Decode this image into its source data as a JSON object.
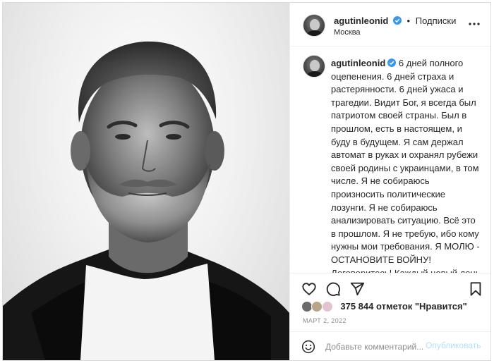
{
  "post": {
    "username": "agutinleonid",
    "follow_label": "Подписки",
    "location": "Москва",
    "caption": "6 дней полного оцепенения. 6 дней страха и растерянности. 6 дней ужаса и трагедии. Видит Бог, я всегда был патриотом своей страны. Был в прошлом, есть в настоящем, и буду в будущем. Я сам держал автомат в руках и охранял рубежи своей родины с украинцами, в том числе. Я не собираюсь произносить политические лозунги. Я не собираюсь анализировать ситуацию. Всё это в прошлом. Я не требую, ибо кому нужны мои требования. Я МОЛЮ - ОСТАНОВИТЕ ВОЙНУ! Договоритесь! Каждый новый день - это новые смерти наших ребят, украинских граждан, миллионы поломанных судеб с той и с другой",
    "likes_text": "375 844 отметок \"Нравится\"",
    "date": "МАРТ 2, 2022",
    "comment_placeholder": "Добавьте комментарий...",
    "publish_label": "Опубликовать"
  },
  "icons": {
    "verified": "verified-badge-icon",
    "more": "more-options-icon",
    "like": "heart-icon",
    "comment": "comment-icon",
    "share": "paper-plane-icon",
    "save": "bookmark-icon",
    "emoji": "emoji-icon"
  },
  "colors": {
    "verified_blue": "#3897f0",
    "link_disabled": "#b2dffc",
    "muted": "#8e8e8e",
    "text": "#262626"
  }
}
